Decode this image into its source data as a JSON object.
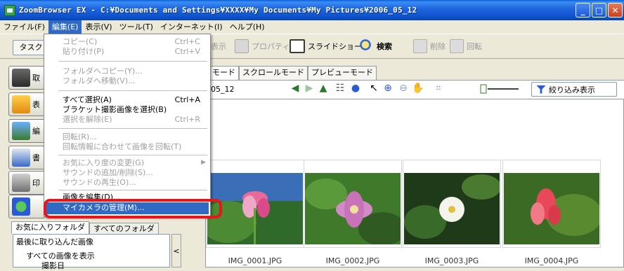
{
  "window": {
    "title": "ZoomBrowser EX  -  C:¥Documents and Settings¥XXXX¥My Documents¥My Pictures¥2006_05_12"
  },
  "menubar": {
    "items": [
      {
        "label": "ファイル(F)"
      },
      {
        "label": "編集(E)"
      },
      {
        "label": "表示(V)"
      },
      {
        "label": "ツール(T)"
      },
      {
        "label": "インターネット(I)"
      },
      {
        "label": "ヘルプ(H)"
      }
    ]
  },
  "toolbar": {
    "task_label": "タスク",
    "view_label": "表示",
    "properties_label": "プロパティ",
    "slideshow_label": "スライドショー",
    "search_label": "検索",
    "delete_label": "削除",
    "rotate_label": "回転"
  },
  "edit_menu": {
    "copy": "コピー(C)",
    "copy_short": "Ctrl+C",
    "paste": "貼り付け(P)",
    "paste_short": "Ctrl+V",
    "copy_to_folder": "フォルダへコピー(Y)...",
    "move_to_folder": "フォルダへ移動(V)...",
    "select_all": "すべて選択(A)",
    "select_all_short": "Ctrl+A",
    "select_bracket": "ブラケット撮影画像を選択(B)",
    "deselect": "選択を解除(E)",
    "deselect_short": "Ctrl+R",
    "rotate": "回転(R)...",
    "rotate_info": "回転情報に合わせて画像を回転(T)",
    "favorite": "お気に入り度の変更(G)",
    "sound_add": "サウンドの追加/削除(S)...",
    "sound_play": "サウンドの再生(O)...",
    "edit_image": "画像を編集(D)...",
    "my_camera": "マイカメラの管理(M)..."
  },
  "sidebar": {
    "buttons": [
      {
        "label": "取"
      },
      {
        "label": "表"
      },
      {
        "label": "編"
      },
      {
        "label": "書"
      },
      {
        "label": "印"
      },
      {
        "label": ""
      }
    ],
    "folder_tabs": [
      "お気に入りフォルダ",
      "すべてのフォルダ"
    ],
    "tree": [
      "最後に取り込んだ画像",
      "すべての画像を表示",
      "撮影日"
    ]
  },
  "main": {
    "view_tabs": [
      "モード",
      "スクロールモード",
      "プレビューモード"
    ],
    "path": "05_12",
    "filter_label": "絞り込み表示",
    "thumbnails": [
      {
        "caption": "IMG_0001.JPG"
      },
      {
        "caption": "IMG_0002.JPG"
      },
      {
        "caption": "IMG_0003.JPG"
      },
      {
        "caption": "IMG_0004.JPG"
      }
    ]
  },
  "colors": {
    "highlight": "#316ac5",
    "annotation_red": "#e8151b"
  }
}
